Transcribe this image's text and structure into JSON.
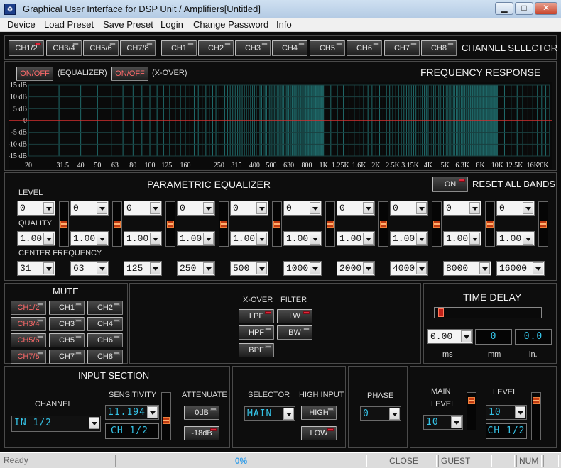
{
  "window": {
    "title": "Graphical User Interface for DSP Unit / Amplifiers[Untitled]",
    "icon": "app-icon",
    "minimize": "▁",
    "maximize": "□",
    "close": "✕"
  },
  "menu": [
    "Device",
    "Load Preset",
    "Save Preset",
    "Login",
    "Change Password",
    "Info"
  ],
  "channel_selector": {
    "title": "CHANNEL SELECTOR",
    "groups": [
      "CH1/2",
      "CH3/4",
      "CH5/6",
      "CH7/8"
    ],
    "channels": [
      "CH1",
      "CH2",
      "CH3",
      "CH4",
      "CH5",
      "CH6",
      "CH7",
      "CH8"
    ],
    "active": "CH1/2"
  },
  "freq": {
    "title": "FREQUENCY RESPONSE",
    "eq_toggle": "ON/OFF",
    "eq_label": "(EQUALIZER)",
    "xover_toggle": "ON/OFF",
    "xover_label": "(X-OVER)",
    "db_labels": [
      "15 dB",
      "10 dB",
      "5 dB",
      "0",
      "-5 dB",
      "-10 dB",
      "-15 dB"
    ],
    "freq_labels": [
      "20",
      "31.5",
      "40",
      "50",
      "63",
      "80",
      "100",
      "125",
      "160",
      "250",
      "315",
      "400",
      "500",
      "630",
      "800",
      "1K",
      "1.25K",
      "1.6K",
      "2K",
      "2.5K",
      "3.15K",
      "4K",
      "5K",
      "6.3K",
      "8K",
      "10K",
      "12.5K",
      "16K",
      "20K"
    ],
    "curve_color": "#d43030",
    "grid_color": "#1f6b6b"
  },
  "peq": {
    "title": "PARAMETRIC EQUALIZER",
    "reset_btn": "ON",
    "reset_label": "RESET ALL BANDS",
    "level_label": "LEVEL",
    "quality_label": "QUALITY",
    "center_label": "CENTER FREQUENCY",
    "levels": [
      "0",
      "0",
      "0",
      "0",
      "0",
      "0",
      "0",
      "0",
      "0",
      "0"
    ],
    "qualities": [
      "1.00",
      "1.00",
      "1.00",
      "1.00",
      "1.00",
      "1.00",
      "1.00",
      "1.00",
      "1.00",
      "1.00"
    ],
    "centers": [
      "31",
      "63",
      "125",
      "250",
      "500",
      "1000",
      "2000",
      "4000",
      "8000",
      "16000"
    ]
  },
  "mute": {
    "title": "MUTE",
    "buttons": [
      "CH1/2",
      "CH1",
      "CH2",
      "CH3/4",
      "CH3",
      "CH4",
      "CH5/6",
      "CH5",
      "CH6",
      "CH7/8",
      "CH7",
      "CH8"
    ]
  },
  "xover": {
    "xover_label": "X-OVER",
    "filter_label": "FILTER",
    "lpf": "LPF",
    "hpf": "HPF",
    "bpf": "BPF",
    "lw": "LW",
    "bw": "BW"
  },
  "delay": {
    "title": "TIME DELAY",
    "ms_value": "0.00",
    "mm_value": "0",
    "in_value": "0.0",
    "ms_label": "ms",
    "mm_label": "mm",
    "in_label": "in.",
    "slider_fraction": 0
  },
  "input": {
    "title": "INPUT SECTION",
    "channel_label": "CHANNEL",
    "channel_value": "IN 1/2",
    "sensitivity_label": "SENSITIVITY",
    "sensitivity_value": "11.194",
    "sensitivity_display": "CH 1/2",
    "attenuate_label": "ATTENUATE",
    "att_0": "0dB",
    "att_18": "-18dB"
  },
  "selector": {
    "label": "SELECTOR",
    "value": "MAIN",
    "high_input_label": "HIGH INPUT",
    "high": "HIGH",
    "low": "LOW"
  },
  "phase": {
    "label": "PHASE",
    "value": "0"
  },
  "level_section": {
    "main_label": "MAIN",
    "level_label_left": "LEVEL",
    "main_value": "10",
    "level_label": "LEVEL",
    "level_value": "10",
    "level_display": "CH 1/2"
  },
  "status": {
    "ready": "Ready",
    "progress": "0%",
    "close": "CLOSE",
    "user": "GUEST",
    "num": "NUM"
  }
}
